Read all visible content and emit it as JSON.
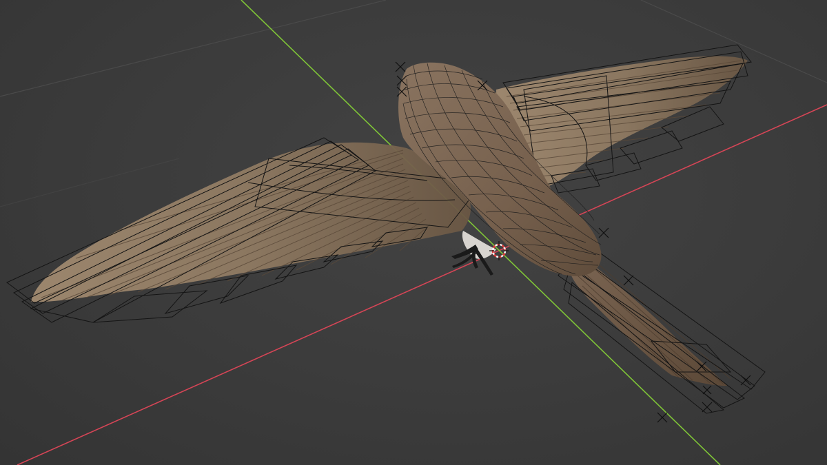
{
  "viewport": {
    "mode": "3d-viewport-wireframe-overlay",
    "colors": {
      "background": "#3b3b3b",
      "grid": "#4a4a4a",
      "x_axis": "#d64556",
      "y_axis": "#7fc437",
      "feather_light": "#8f7a62",
      "feather_dark": "#5e4d3c",
      "body": "#7a6552",
      "wire": "#141414",
      "feet": "#1a1a1a",
      "cursor_red": "#e23b3b",
      "cursor_white": "#f2f2f2"
    },
    "scene_object": "bird-mesh",
    "icons": [
      "3d-cursor-icon",
      "empty-marker-icon"
    ]
  }
}
